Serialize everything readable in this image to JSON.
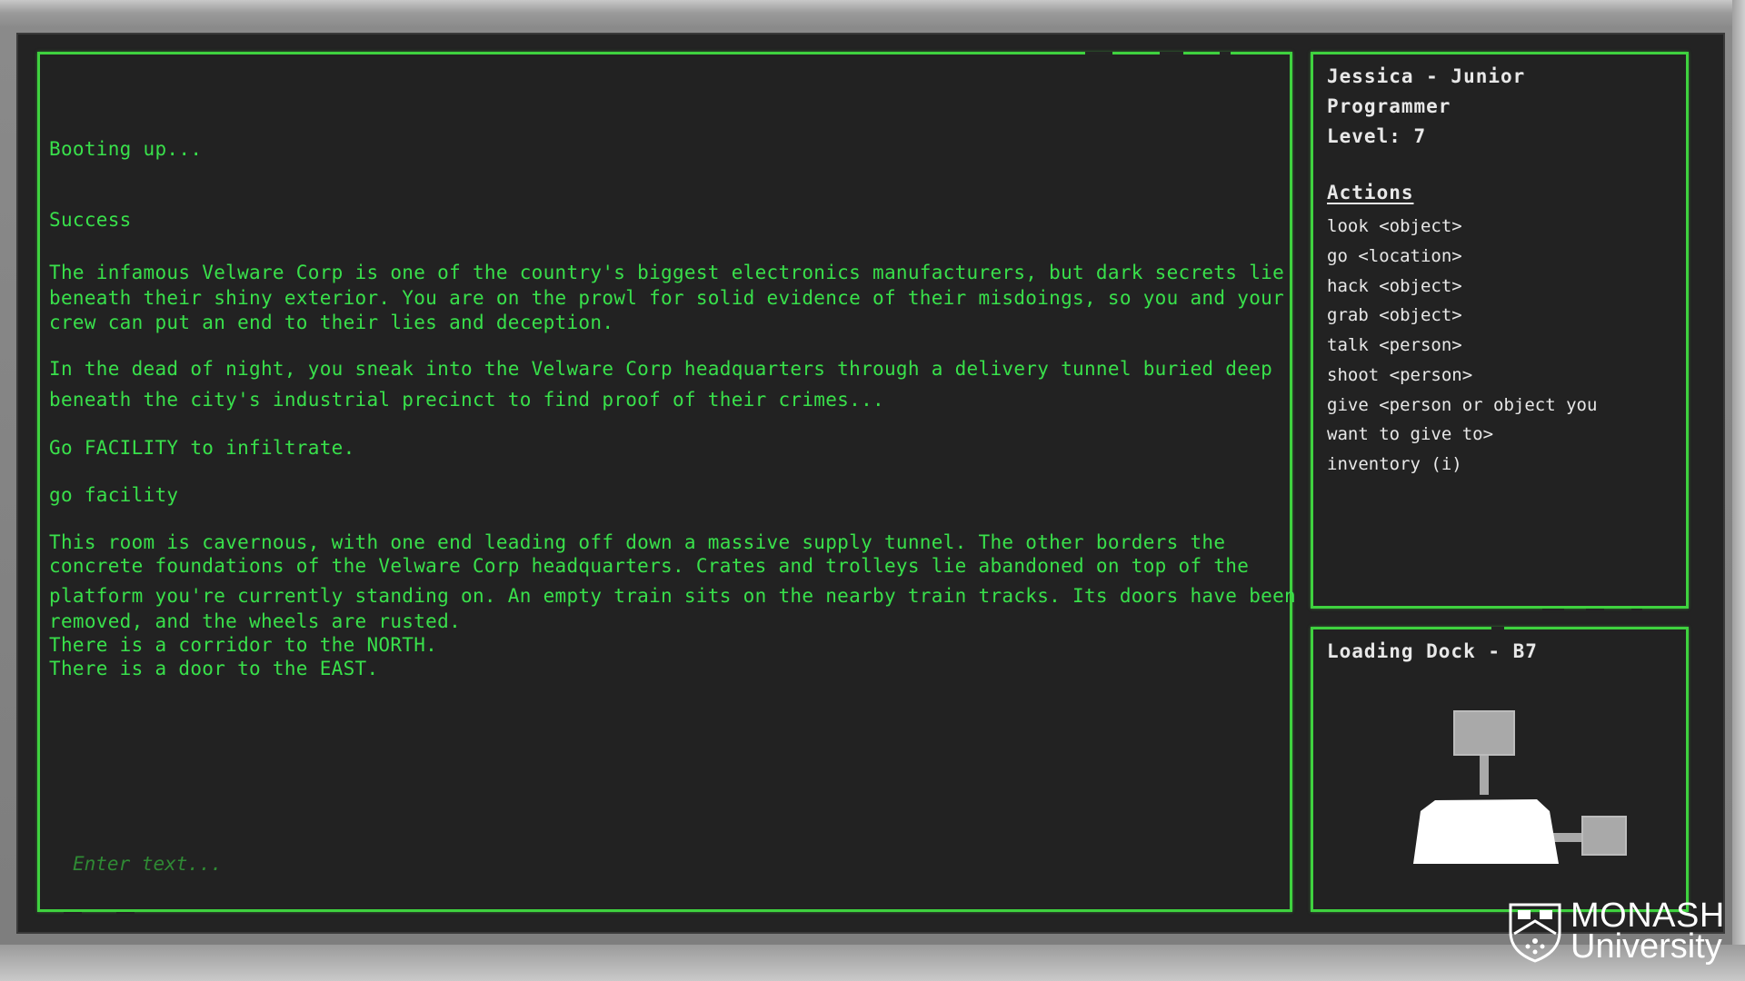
{
  "console": {
    "lines": [
      "Booting up...",
      "Success",
      "The infamous Velware Corp is one of the country's biggest electronics manufacturers, but dark secrets lie",
      "beneath their shiny exterior. You are on the prowl for solid evidence of their misdoings, so you and your",
      "crew can put an end to their lies and deception.",
      "In the dead of night, you sneak into the Velware Corp headquarters through a delivery tunnel buried deep",
      "beneath the city's industrial precinct to find proof of their crimes...",
      "Go FACILITY to infiltrate.",
      "go facility",
      "This room is cavernous, with one end leading off down a massive supply tunnel. The other borders the",
      "concrete foundations of the Velware Corp headquarters. Crates and trolleys lie abandoned on top of the",
      "platform you're currently standing on. An empty train sits on the nearby train tracks. Its doors have been",
      "removed, and the wheels are rusted.",
      "There is a corridor to the NORTH.",
      "There is a door to the EAST."
    ],
    "input_placeholder": "Enter text..."
  },
  "status": {
    "player_line1": "Jessica - Junior",
    "player_line2": "Programmer",
    "level": "Level: 7",
    "actions_heading": "Actions",
    "actions": [
      "look <object>",
      "go <location>",
      "hack <object>",
      "grab <object>",
      "talk <person>",
      "shoot <person>",
      "give <person or object you",
      "want to give to>",
      "inventory (i)"
    ]
  },
  "map": {
    "title": "Loading Dock - B7",
    "rooms": [
      {
        "name": "north-room",
        "current": false
      },
      {
        "name": "current-room",
        "current": true
      },
      {
        "name": "east-room",
        "current": false
      }
    ]
  },
  "logo": {
    "name": "MONASH",
    "sub": "University"
  },
  "colors": {
    "terminal_green": "#39e04b",
    "panel_border": "#3fd23f",
    "placeholder_green": "#2f8a34",
    "screen_bg": "#232323"
  }
}
